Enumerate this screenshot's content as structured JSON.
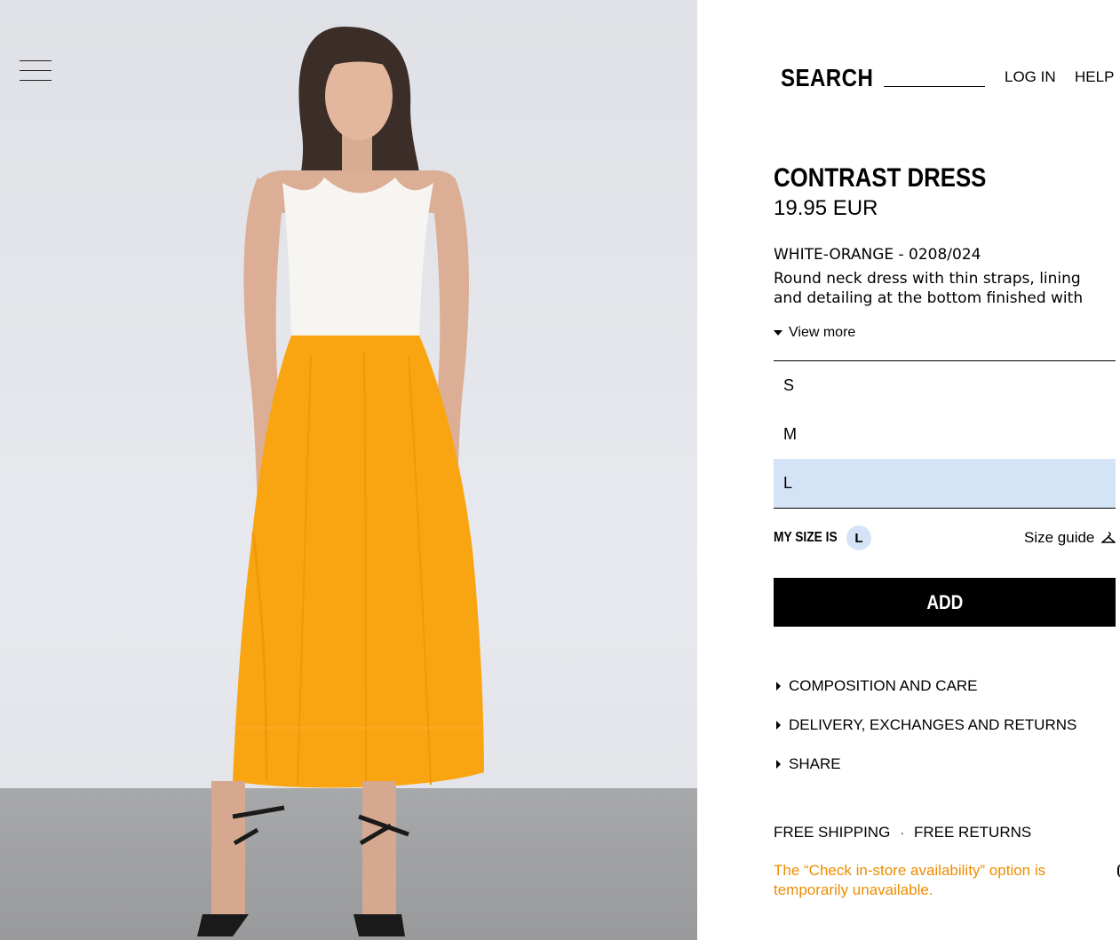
{
  "header": {
    "search_label": "SEARCH",
    "search_value": "",
    "login_label": "LOG IN",
    "help_label": "HELP",
    "menu_icon": "hamburger-menu-icon"
  },
  "product": {
    "name": "CONTRAST DRESS",
    "price": "19.95 EUR",
    "color_ref": "WHITE-ORANGE - 0208/024",
    "description": "Round neck dress with thin straps, lining and detailing at the bottom finished with",
    "view_more_label": "View more"
  },
  "sizes": {
    "options": [
      "S",
      "M",
      "L"
    ],
    "selected": "L",
    "my_size_label": "MY SIZE IS",
    "my_size_value": "L",
    "size_guide_label": "Size guide",
    "size_guide_icon": "hanger-icon"
  },
  "actions": {
    "add_label": "ADD"
  },
  "accordion": [
    {
      "label": "COMPOSITION AND CARE"
    },
    {
      "label": "DELIVERY, EXCHANGES AND RETURNS"
    },
    {
      "label": "SHARE"
    }
  ],
  "footer": {
    "free_shipping": "FREE SHIPPING",
    "separator": "·",
    "free_returns": "FREE RETURNS",
    "notice": "The “Check in-store availability” option is temporarily unavailable."
  },
  "colors": {
    "selected_size_bg": "#d4e3f5",
    "notice_text": "#ee8c00",
    "button_bg": "#000000",
    "dress_orange": "#f9a512"
  }
}
